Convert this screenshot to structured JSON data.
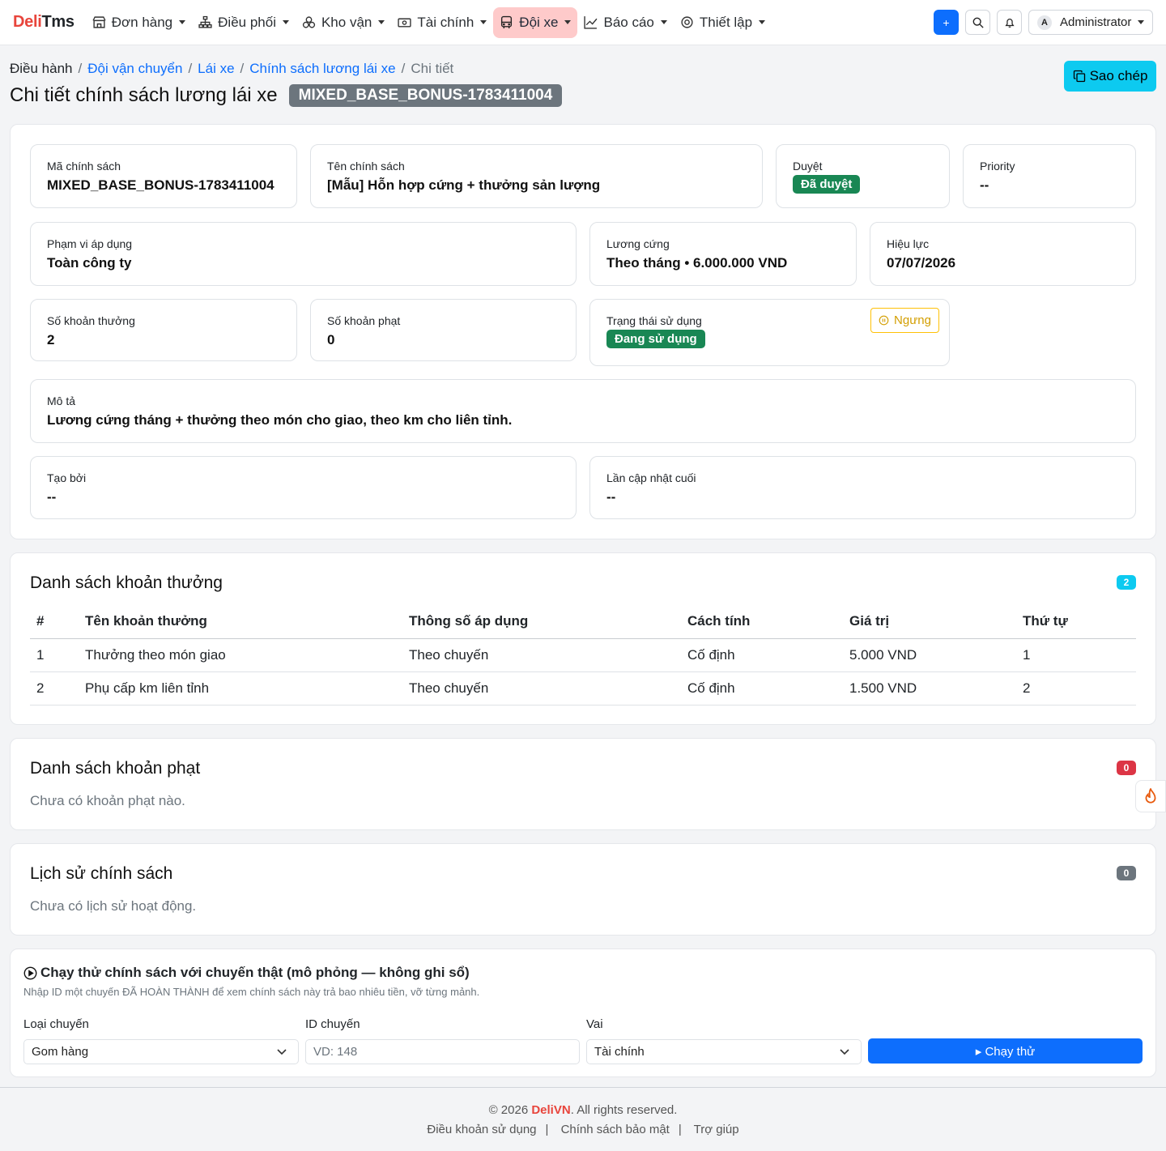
{
  "brand": {
    "part1": "Deli",
    "part2": "Tms"
  },
  "nav": {
    "items": [
      {
        "label": "Đơn hàng",
        "icon": "store-icon"
      },
      {
        "label": "Điều phối",
        "icon": "sitemap-icon"
      },
      {
        "label": "Kho vận",
        "icon": "boxes-icon"
      },
      {
        "label": "Tài chính",
        "icon": "cash-icon"
      },
      {
        "label": "Đội xe",
        "icon": "bus-icon"
      },
      {
        "label": "Báo cáo",
        "icon": "chart-line-icon"
      },
      {
        "label": "Thiết lập",
        "icon": "gear-icon"
      }
    ],
    "active_index": 4,
    "add_label": "+",
    "user_initial": "A",
    "user_name": "Administrator"
  },
  "breadcrumb": [
    "Điều hành",
    "Đội vận chuyển",
    "Lái xe",
    "Chính sách lương lái xe",
    "Chi tiết"
  ],
  "header": {
    "title": "Chi tiết chính sách lương lái xe",
    "code": "MIXED_BASE_BONUS-1783411004",
    "copy_label": "Sao chép"
  },
  "info": {
    "code_label": "Mã chính sách",
    "code_value": "MIXED_BASE_BONUS-1783411004",
    "name_label": "Tên chính sách",
    "name_value": "[Mẫu] Hỗn hợp cứng + thưởng sản lượng",
    "approval_label": "Duyệt",
    "approval_value": "Đã duyệt",
    "priority_label": "Priority",
    "priority_value": "--",
    "scope_label": "Phạm vi áp dụng",
    "scope_value": "Toàn công ty",
    "salary_label": "Lương cứng",
    "salary_value": "Theo tháng • 6.000.000 VND",
    "effective_label": "Hiệu lực",
    "effective_value": "07/07/2026",
    "bonus_count_label": "Số khoản thưởng",
    "bonus_count_value": "2",
    "penalty_count_label": "Số khoản phạt",
    "penalty_count_value": "0",
    "status_label": "Trạng thái sử dụng",
    "status_value": "Đang sử dụng",
    "stop_label": "Ngưng",
    "desc_label": "Mô tả",
    "desc_value": "Lương cứng tháng + thưởng theo món cho giao, theo km cho liên tỉnh.",
    "created_label": "Tạo bởi",
    "created_value": "--",
    "updated_label": "Lần cập nhật cuối",
    "updated_value": "--"
  },
  "bonus": {
    "title": "Danh sách khoản thưởng",
    "count": "2",
    "columns": [
      "#",
      "Tên khoản thưởng",
      "Thông số áp dụng",
      "Cách tính",
      "Giá trị",
      "Thứ tự"
    ],
    "rows": [
      [
        "1",
        "Thưởng theo món giao",
        "Theo chuyến",
        "Cố định",
        "5.000 VND",
        "1"
      ],
      [
        "2",
        "Phụ cấp km liên tỉnh",
        "Theo chuyến",
        "Cố định",
        "1.500 VND",
        "2"
      ]
    ]
  },
  "penalty": {
    "title": "Danh sách khoản phạt",
    "count": "0",
    "empty": "Chưa có khoản phạt nào."
  },
  "history": {
    "title": "Lịch sử chính sách",
    "count": "0",
    "empty": "Chưa có lịch sử hoạt động."
  },
  "simulate": {
    "title": "Chạy thử chính sách với chuyến thật (mô phỏng — không ghi sổ)",
    "hint": "Nhập ID một chuyến ĐÃ HOÀN THÀNH để xem chính sách này trả bao nhiêu tiền, vỡ từng mảnh.",
    "trip_type_label": "Loại chuyến",
    "trip_type_value": "Gom hàng",
    "trip_id_label": "ID chuyến",
    "trip_id_placeholder": "VD: 148",
    "role_label": "Vai",
    "role_value": "Tài chính",
    "run_label": "▸ Chạy thử"
  },
  "footer": {
    "copyright_pre": "© 2026 ",
    "copyright_brand": "DeliVN",
    "copyright_post": ". All rights reserved.",
    "links": [
      "Điều khoản sử dụng",
      "Chính sách bảo mật",
      "Trợ giúp"
    ]
  },
  "colors": {
    "primary": "#0d6efd",
    "info": "#0dcaf0",
    "success": "#198754",
    "danger": "#dc3545",
    "secondary": "#6c757d",
    "warning": "#ffc107",
    "brand": "#e8453c"
  }
}
